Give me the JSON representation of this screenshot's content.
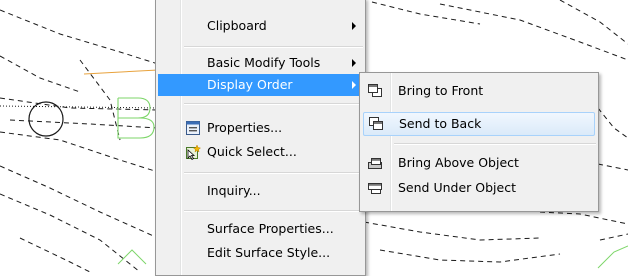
{
  "context_menu": {
    "items": [
      {
        "label": "Clipboard",
        "has_submenu": true
      },
      {
        "label": "Basic Modify Tools",
        "has_submenu": true
      },
      {
        "label": "Display Order",
        "has_submenu": true,
        "highlighted": true
      },
      {
        "label": "Properties...",
        "icon": "properties-icon"
      },
      {
        "label": "Quick Select...",
        "icon": "quick-select-icon"
      },
      {
        "label": "Inquiry..."
      },
      {
        "label": "Surface Properties..."
      },
      {
        "label": "Edit Surface Style..."
      }
    ]
  },
  "display_order_submenu": {
    "items": [
      {
        "label": "Bring to Front",
        "icon": "bring-to-front-icon"
      },
      {
        "label": "Send to Back",
        "icon": "send-to-back-icon",
        "hovered": true
      },
      {
        "label": "Bring Above Object",
        "icon": "bring-above-object-icon"
      },
      {
        "label": "Send Under Object",
        "icon": "send-under-object-icon"
      }
    ]
  },
  "colors": {
    "highlight": "#3399ff",
    "menu_background": "#f0f0f0",
    "drawing_lines": "#1a1a1a",
    "drawing_green": "#7ed66a",
    "drawing_orange": "#e8a23c"
  }
}
